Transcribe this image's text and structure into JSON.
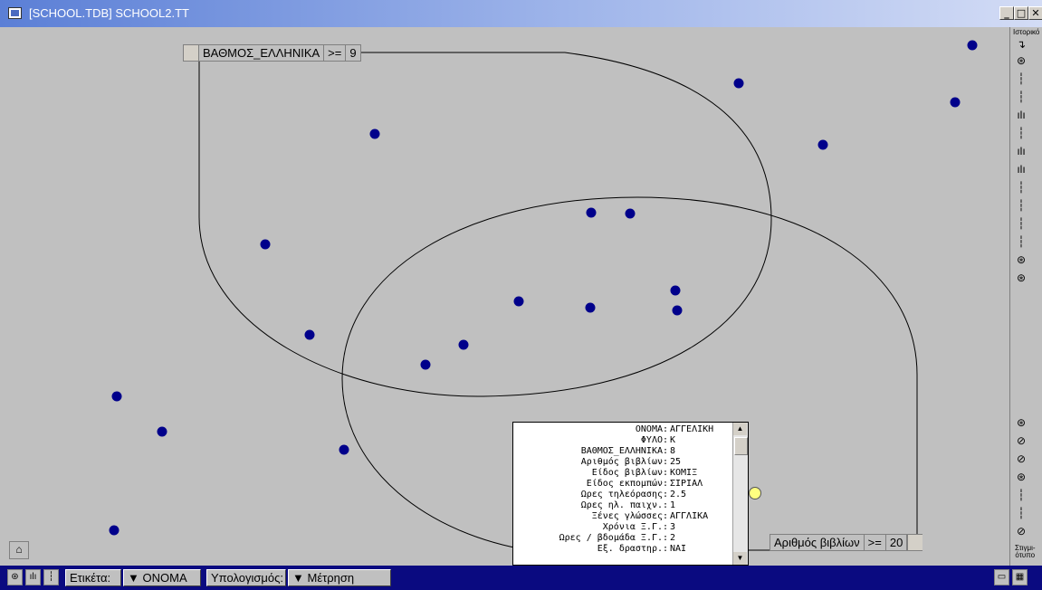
{
  "window": {
    "title": "[SCHOOL.TDB] SCHOOL2.TT",
    "minimize_icon": "minimize-icon",
    "maximize_icon": "maximize-icon",
    "close_icon": "close-icon"
  },
  "conditions": [
    {
      "field": "ΒΑΘΜΟΣ_ΕΛΛΗΝΙΚΑ",
      "op": ">=",
      "value": "9"
    },
    {
      "field": "Αριθμός βιβλίων",
      "op": ">=",
      "value": "20"
    }
  ],
  "colors": {
    "point": "#00008b",
    "statusbar": "#0a0a80",
    "panel_bg": "#c0c0c0"
  },
  "info_panel": {
    "rows": [
      {
        "key": "ΟΝΟΜΑ",
        "value": "ΑΓΓΕΛΙΚΗ"
      },
      {
        "key": "ΦΥΛΟ",
        "value": "Κ"
      },
      {
        "key": "ΒΑΘΜΟΣ_ΕΛΛΗΝΙΚΑ",
        "value": "8"
      },
      {
        "key": "Αριθμός βιβλίων",
        "value": "25"
      },
      {
        "key": "Είδος βιβλίων",
        "value": "ΚΟΜΙΞ"
      },
      {
        "key": "Είδος εκπομπών",
        "value": "ΣΙΡΙΑΛ"
      },
      {
        "key": "Ωρες τηλεόρασης",
        "value": "2.5"
      },
      {
        "key": "Ωρες ηλ. παιχν.",
        "value": "1"
      },
      {
        "key": "Ξένες γλώσσες",
        "value": "ΑΓΓΛΙΚΑ"
      },
      {
        "key": "Χρόνια Ξ.Γ.",
        "value": "3"
      },
      {
        "key": "Ωρες / βδομάδα Ξ.Γ.",
        "value": "2"
      },
      {
        "key": "Εξ. δραστηρ.",
        "value": "ΝΑΙ"
      }
    ]
  },
  "right_rail": {
    "top_label": "Ιστορικό",
    "bottom_label_1": "Στιγμι-",
    "bottom_label_2": "ότυπο"
  },
  "statusbar": {
    "label_caption": "Ετικέτα:",
    "label_value": "ΟΝΟΜΑ",
    "calc_caption": "Υπολογισμός:",
    "calc_value": "Μέτρηση"
  }
}
